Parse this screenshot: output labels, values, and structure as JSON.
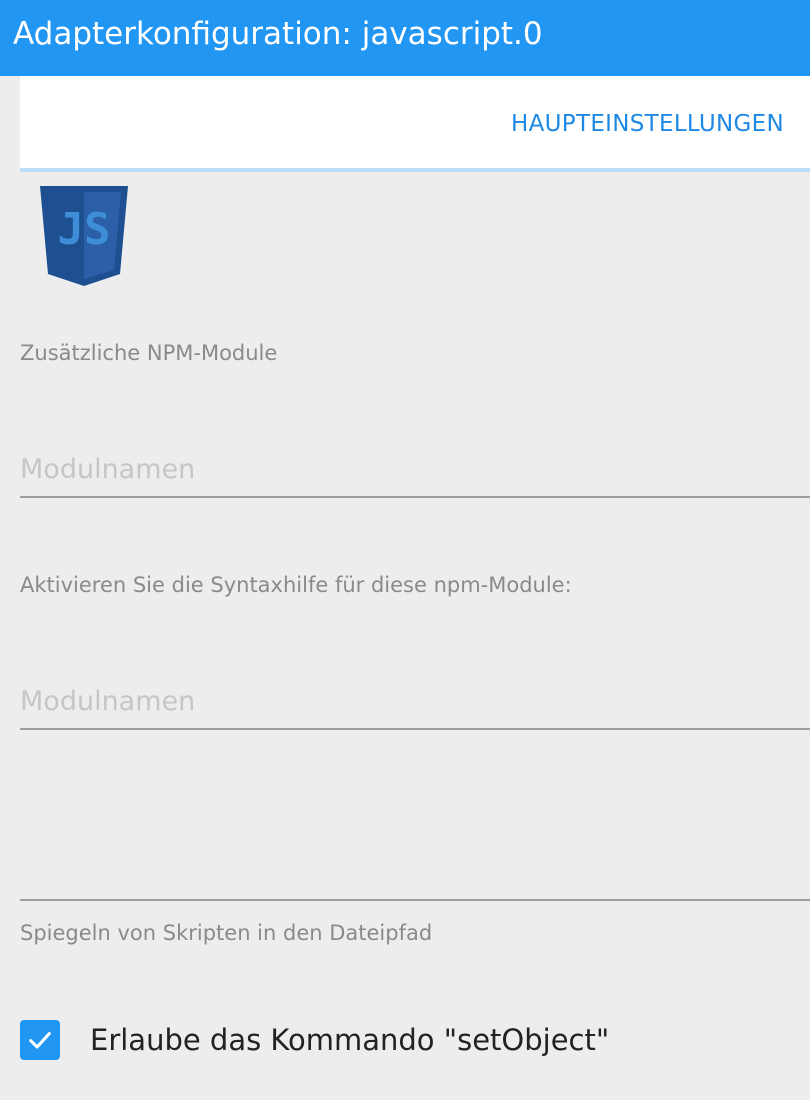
{
  "header": {
    "title": "Adapterkonfiguration: javascript.0",
    "color": "#2196f3"
  },
  "tabs": [
    {
      "label": "HAUPTEINSTELLUNGEN",
      "active": true
    }
  ],
  "logo": {
    "text": "JS",
    "icon": "javascript-shield-logo"
  },
  "form": {
    "npm_modules": {
      "label": "Zusätzliche NPM-Module",
      "placeholder": "Modulnamen",
      "value": ""
    },
    "syntax_help": {
      "label": "Aktivieren Sie die Syntaxhilfe für diese npm-Module:",
      "placeholder": "Modulnamen",
      "value": ""
    },
    "mirror_path": {
      "label": "Spiegeln von Skripten in den Dateipfad",
      "value": ""
    },
    "allow_set_object": {
      "label": "Erlaube das Kommando \"setObject\"",
      "checked": true
    }
  },
  "colors": {
    "accent": "#2196f3",
    "tab_text": "#1e88e5",
    "background": "#ededed"
  }
}
